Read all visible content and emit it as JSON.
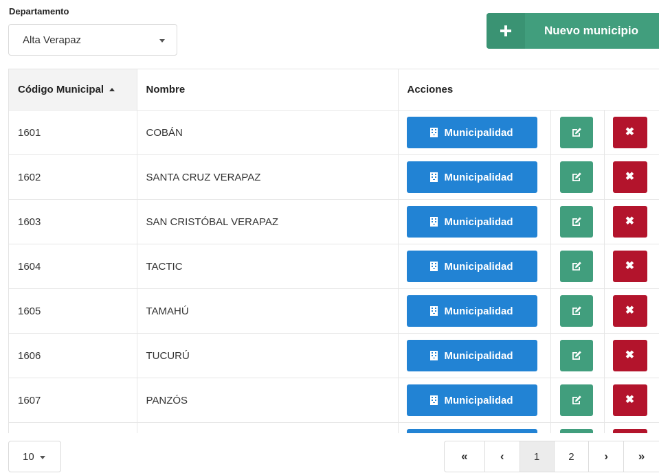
{
  "department": {
    "label": "Departamento",
    "selected": "Alta Verapaz"
  },
  "new_button": {
    "label": "Nuevo municipio",
    "icon": "plus-icon"
  },
  "table": {
    "headers": [
      "Código Municipal",
      "Nombre",
      "Acciones"
    ],
    "sort_column": "Código Municipal",
    "sort_direction": "ascending",
    "action_label": "Municipalidad",
    "rows": [
      {
        "code": "1601",
        "name": "COBÁN"
      },
      {
        "code": "1602",
        "name": "SANTA CRUZ VERAPAZ"
      },
      {
        "code": "1603",
        "name": "SAN CRISTÓBAL VERAPAZ"
      },
      {
        "code": "1604",
        "name": "TACTIC"
      },
      {
        "code": "1605",
        "name": "TAMAHÚ"
      },
      {
        "code": "1606",
        "name": "TUCURÚ"
      },
      {
        "code": "1607",
        "name": "PANZÓS"
      },
      {
        "code": "",
        "name": ""
      }
    ]
  },
  "pagination": {
    "page_size": "10",
    "first": "«",
    "prev": "‹",
    "pages": [
      "1",
      "2"
    ],
    "current_page": "1",
    "next": "›",
    "last": "»"
  },
  "colors": {
    "primary": "#2283d4",
    "success": "#419e7d",
    "danger": "#b3142c"
  }
}
